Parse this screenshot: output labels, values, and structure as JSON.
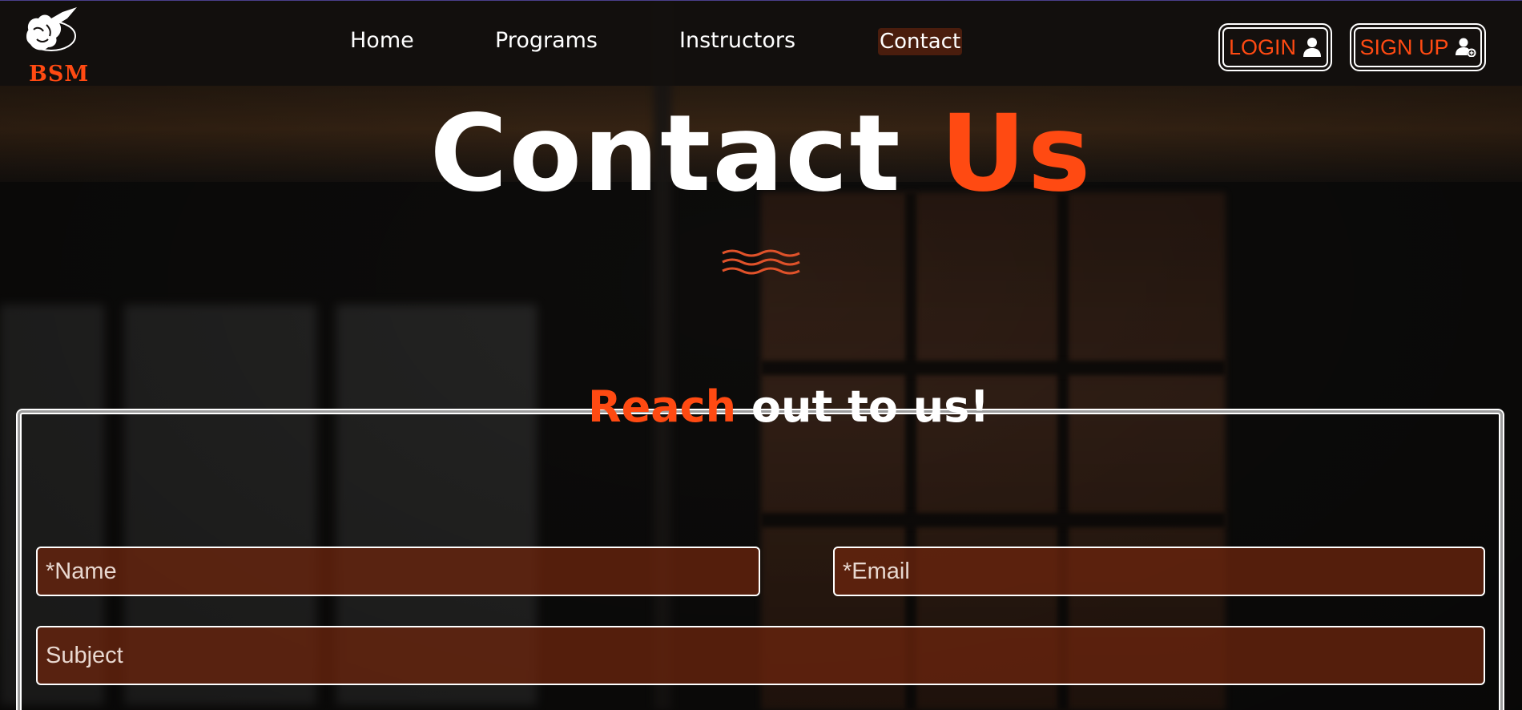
{
  "brand": {
    "logo_text": "BSM",
    "accent": "#ff4a12"
  },
  "nav": {
    "items": [
      {
        "label": "Home"
      },
      {
        "label": "Programs"
      },
      {
        "label": "Instructors"
      },
      {
        "label": "Contact",
        "active": true
      }
    ]
  },
  "auth": {
    "login_label": "LOGIN",
    "login_icon": "user-icon",
    "signup_label": "SIGN UP",
    "signup_icon": "user-add-icon"
  },
  "hero": {
    "title_part1": "Contact",
    "title_part2": "Us",
    "divider_icon": "wave-icon"
  },
  "form": {
    "legend_part1": "Reach",
    "legend_part2": "out to us!",
    "name_placeholder": "*Name",
    "email_placeholder": "*Email",
    "subject_placeholder": "Subject"
  }
}
